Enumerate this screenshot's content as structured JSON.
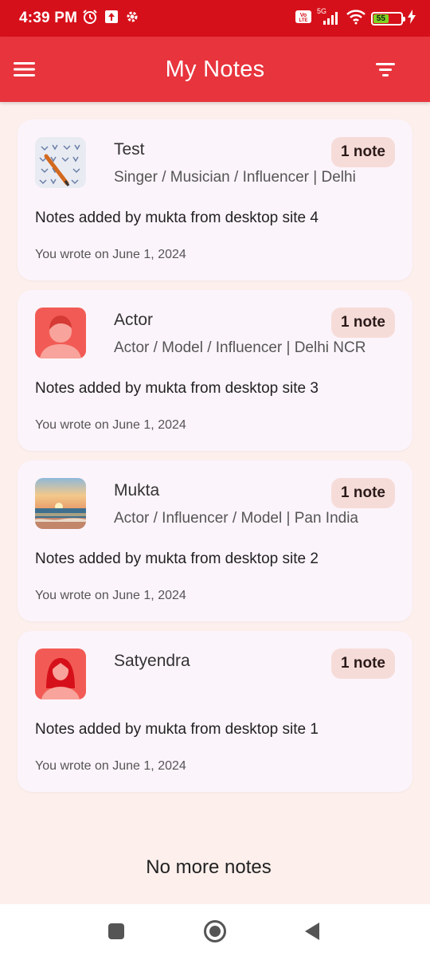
{
  "status_bar": {
    "time": "4:39 PM",
    "network": "5G",
    "battery": "55"
  },
  "app_bar": {
    "title": "My Notes"
  },
  "notes": [
    {
      "name": "Test",
      "subtitle": "Singer / Musician / Influencer | Delhi",
      "badge": "1 note",
      "text": "Notes added by mukta from desktop site 4",
      "date": "You wrote on June 1, 2024",
      "avatar": "notebook-photo"
    },
    {
      "name": "Actor",
      "subtitle": "Actor / Model / Influencer | Delhi NCR",
      "badge": "1 note",
      "text": "Notes added by mukta from desktop site 3",
      "date": "You wrote on June 1, 2024",
      "avatar": "male-placeholder-icon"
    },
    {
      "name": "Mukta",
      "subtitle": "Actor / Influencer / Model | Pan India",
      "badge": "1 note",
      "text": "Notes added by mukta from desktop site 2",
      "date": "You wrote on June 1, 2024",
      "avatar": "sunset-photo"
    },
    {
      "name": "Satyendra",
      "subtitle": "",
      "badge": "1 note",
      "text": "Notes added by mukta from desktop site 1",
      "date": "You wrote on June 1, 2024",
      "avatar": "female-placeholder-icon"
    }
  ],
  "footer": {
    "end_text": "No more notes"
  },
  "colors": {
    "status_bar": "#d6101a",
    "app_bar": "#e8343d",
    "background": "#fcefec",
    "card": "#fcf4fb",
    "badge": "#f6dcd8"
  }
}
